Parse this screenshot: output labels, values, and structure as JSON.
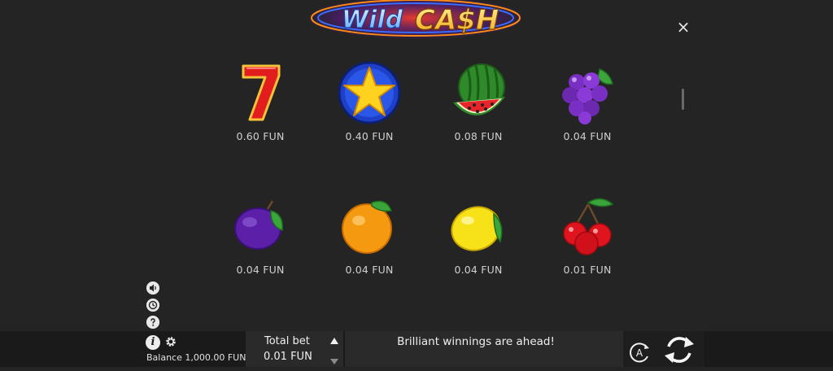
{
  "logo": {
    "word1": "Wild",
    "word2": "CA$H"
  },
  "close_label": "×",
  "paytable": [
    {
      "symbol": "seven",
      "value": "0.60 FUN"
    },
    {
      "symbol": "star",
      "value": "0.40 FUN"
    },
    {
      "symbol": "watermelon",
      "value": "0.08 FUN"
    },
    {
      "symbol": "grapes",
      "value": "0.04 FUN"
    },
    {
      "symbol": "plum",
      "value": "0.04 FUN"
    },
    {
      "symbol": "orange",
      "value": "0.04 FUN"
    },
    {
      "symbol": "lemon",
      "value": "0.04 FUN"
    },
    {
      "symbol": "cherries",
      "value": "0.01 FUN"
    }
  ],
  "side_icons": [
    "sound-icon",
    "history-icon",
    "help-icon"
  ],
  "bottom": {
    "info_label": "i",
    "balance": "Balance 1,000.00 FUN",
    "total_bet_label": "Total bet",
    "total_bet_value": "0.01 FUN",
    "message": "Brilliant winnings are ahead!",
    "auto_label": "A"
  }
}
